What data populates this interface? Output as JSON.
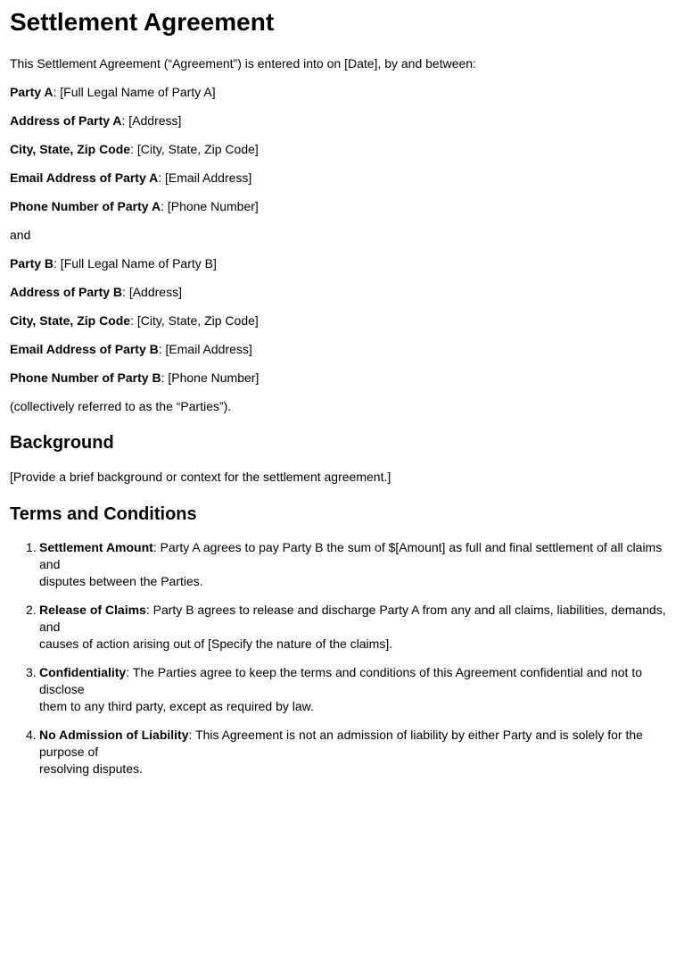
{
  "title": "Settlement Agreement",
  "intro": "This Settlement Agreement (“Agreement”) is entered into on [Date], by and between:",
  "party_a": [
    {
      "label": "Party A",
      "value": ": [Full Legal Name of Party A]"
    },
    {
      "label": "Address of Party A",
      "value": ": [Address]"
    },
    {
      "label": "City, State, Zip Code",
      "value": ": [City, State, Zip Code]"
    },
    {
      "label": "Email Address of Party A",
      "value": ": [Email Address]"
    },
    {
      "label": "Phone Number of Party A",
      "value": ": [Phone Number]"
    }
  ],
  "conjunction": "and",
  "party_b": [
    {
      "label": "Party B",
      "value": ": [Full Legal Name of Party B]"
    },
    {
      "label": "Address of Party B",
      "value": ": [Address]"
    },
    {
      "label": "City, State, Zip Code",
      "value": ": [City, State, Zip Code]"
    },
    {
      "label": "Email Address of Party B",
      "value": ": [Email Address]"
    },
    {
      "label": "Phone Number of Party B",
      "value": ": [Phone Number]"
    }
  ],
  "collective": "(collectively referred to as the “Parties”).",
  "background": {
    "heading": "Background",
    "text": "[Provide a brief background or context for the settlement agreement.]"
  },
  "terms": {
    "heading": "Terms and Conditions",
    "items": [
      {
        "number": "1.",
        "label": "Settlement Amount",
        "line1": ": Party A agrees to pay Party B the sum of $[Amount] as full and final settlement of all claims and",
        "line2": "disputes between the Parties."
      },
      {
        "number": "2.",
        "label": "Release of Claims",
        "line1": ": Party B agrees to release and discharge Party A from any and all claims, liabilities, demands, and",
        "line2": "causes of action arising out of [Specify the nature of the claims]."
      },
      {
        "number": "3.",
        "label": "Confidentiality",
        "line1": ": The Parties agree to keep the terms and conditions of this Agreement confidential and not to disclose",
        "line2": "them to any third party, except as required by law."
      },
      {
        "number": "4.",
        "label": "No Admission of Liability",
        "line1": ": This Agreement is not an admission of liability by either Party and is solely for the purpose of",
        "line2": "resolving disputes."
      }
    ]
  }
}
